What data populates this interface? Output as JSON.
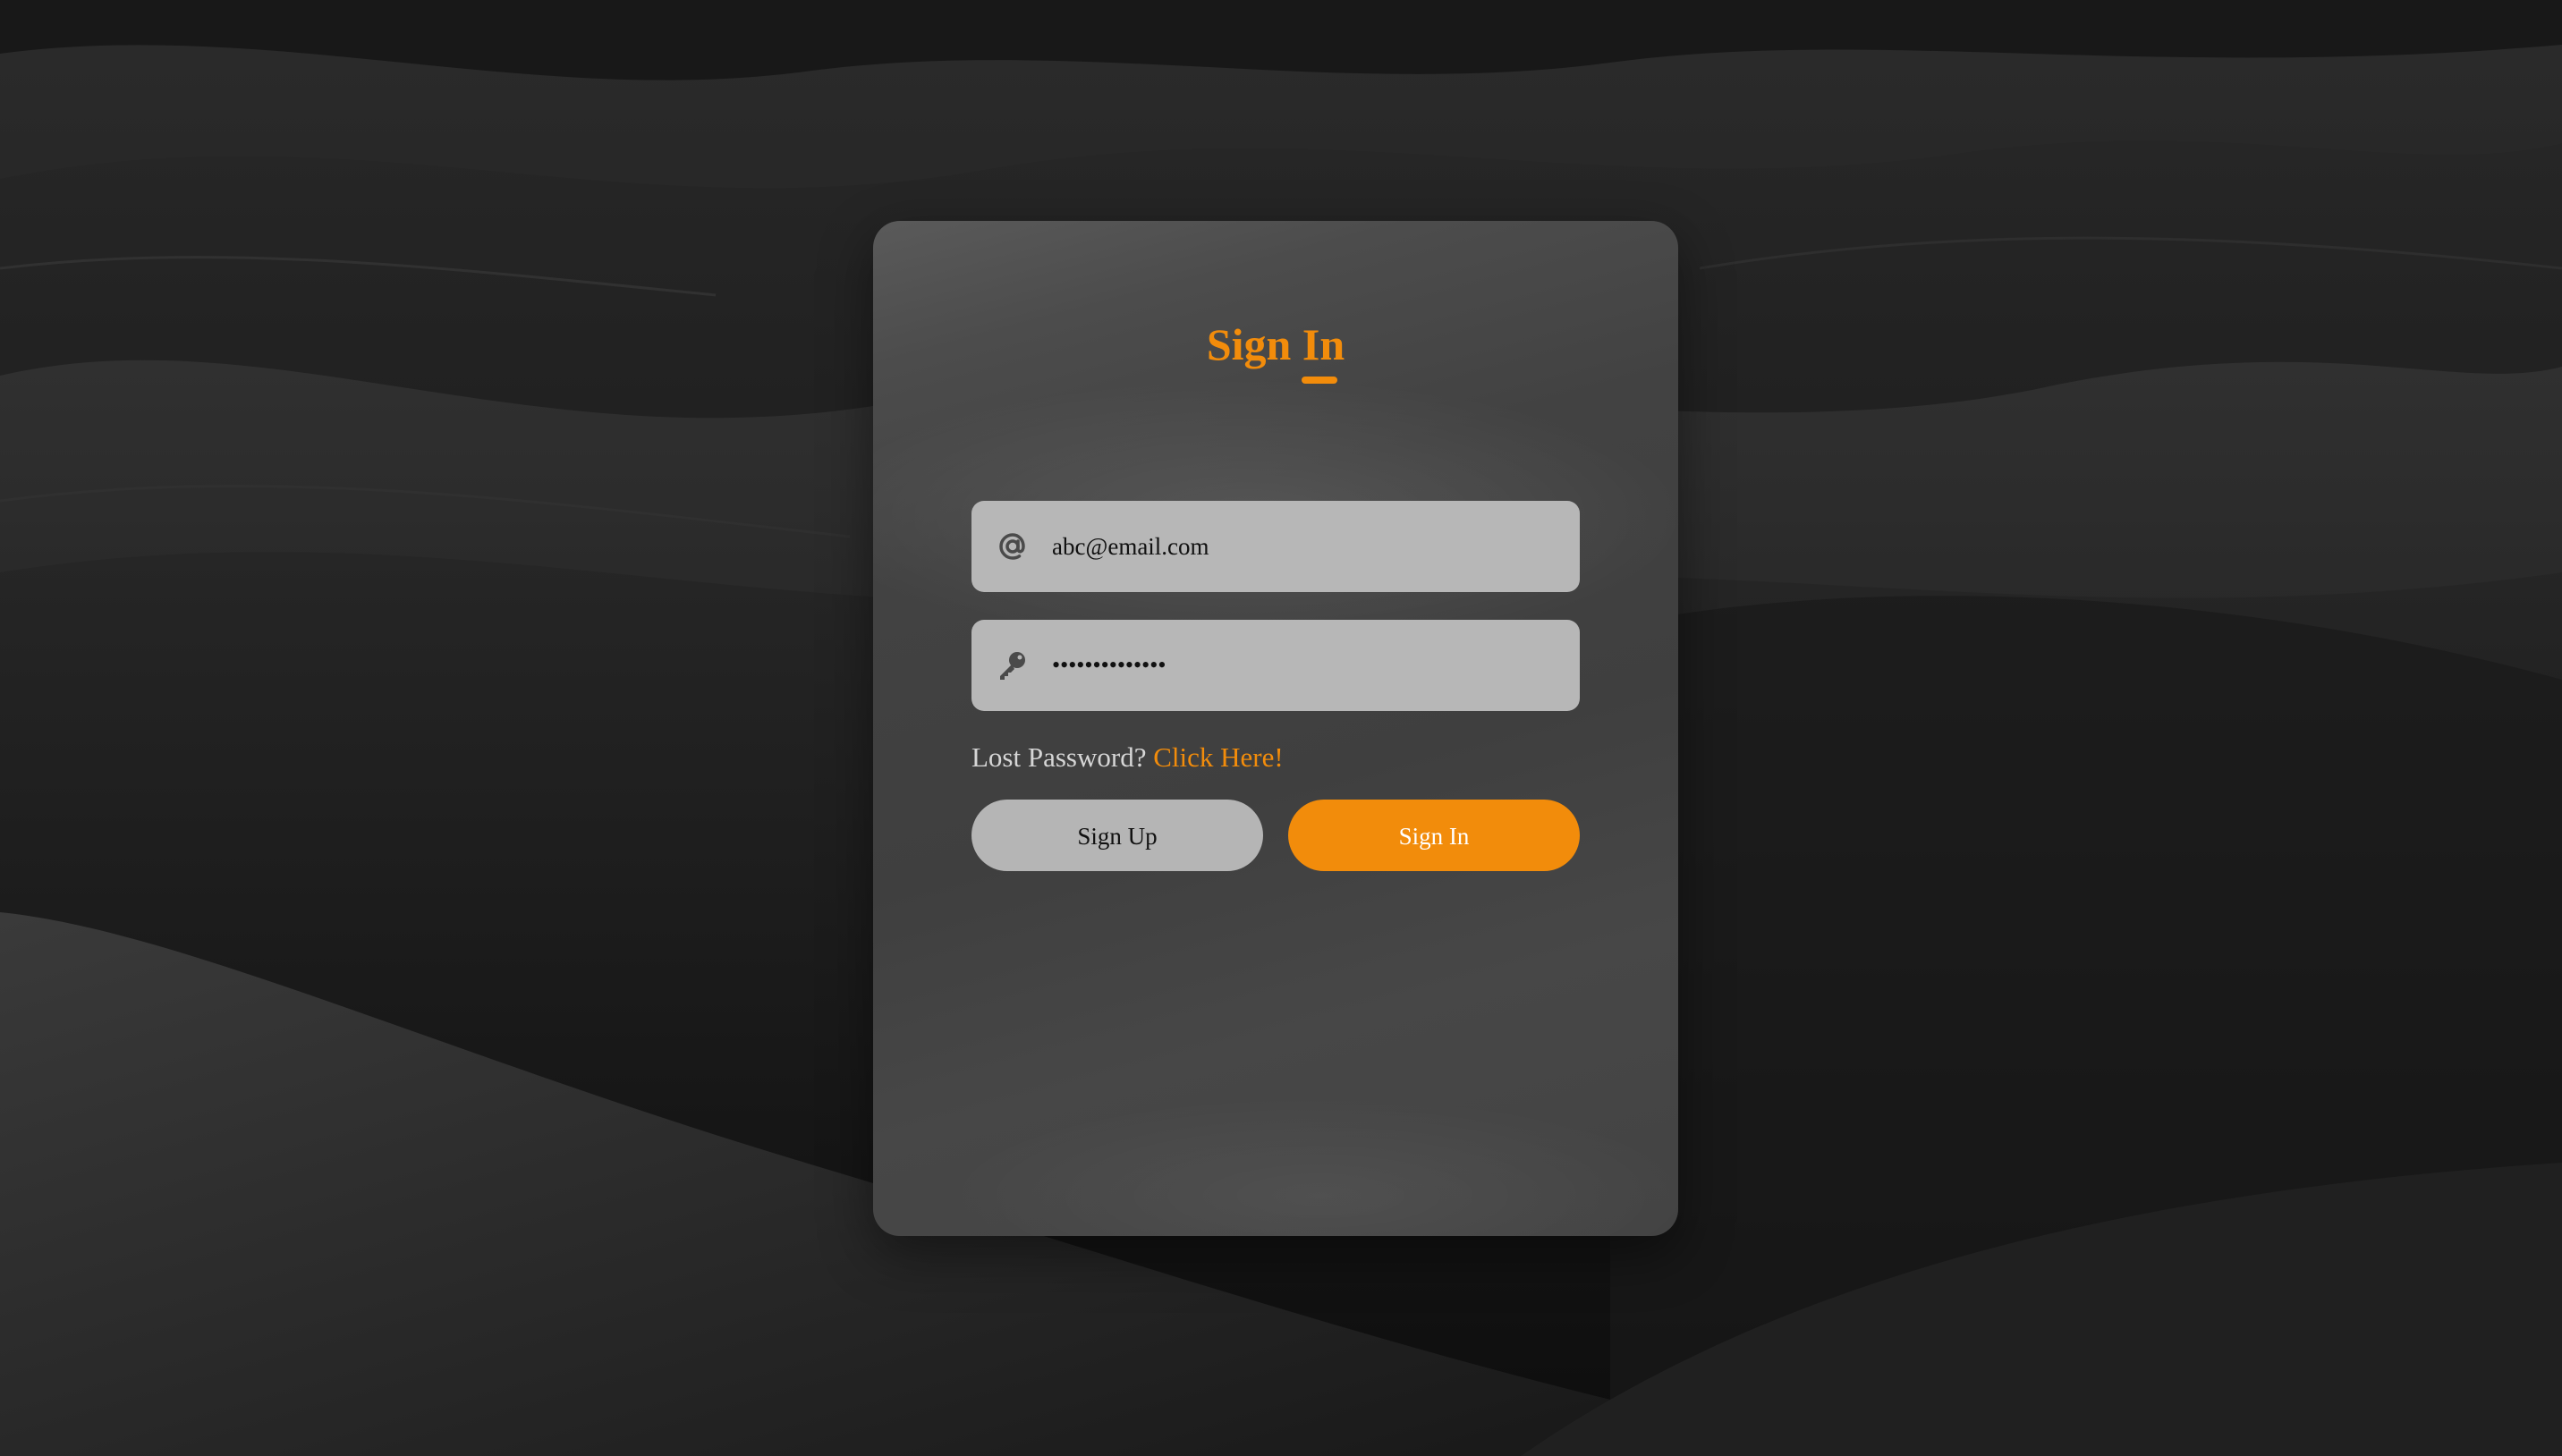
{
  "form": {
    "title": "Sign In",
    "email": {
      "icon": "at-sign-icon",
      "value": "abc@email.com"
    },
    "password": {
      "icon": "key-icon",
      "value": "••••••••••••••"
    },
    "lost_password": {
      "question": "Lost Password?",
      "link_text": "Click Here!"
    },
    "buttons": {
      "sign_up_label": "Sign Up",
      "sign_in_label": "Sign In"
    }
  },
  "colors": {
    "accent": "#f28c0b",
    "field_background": "#b7b7b7",
    "card_background": "#444444",
    "page_background": "#141414"
  }
}
